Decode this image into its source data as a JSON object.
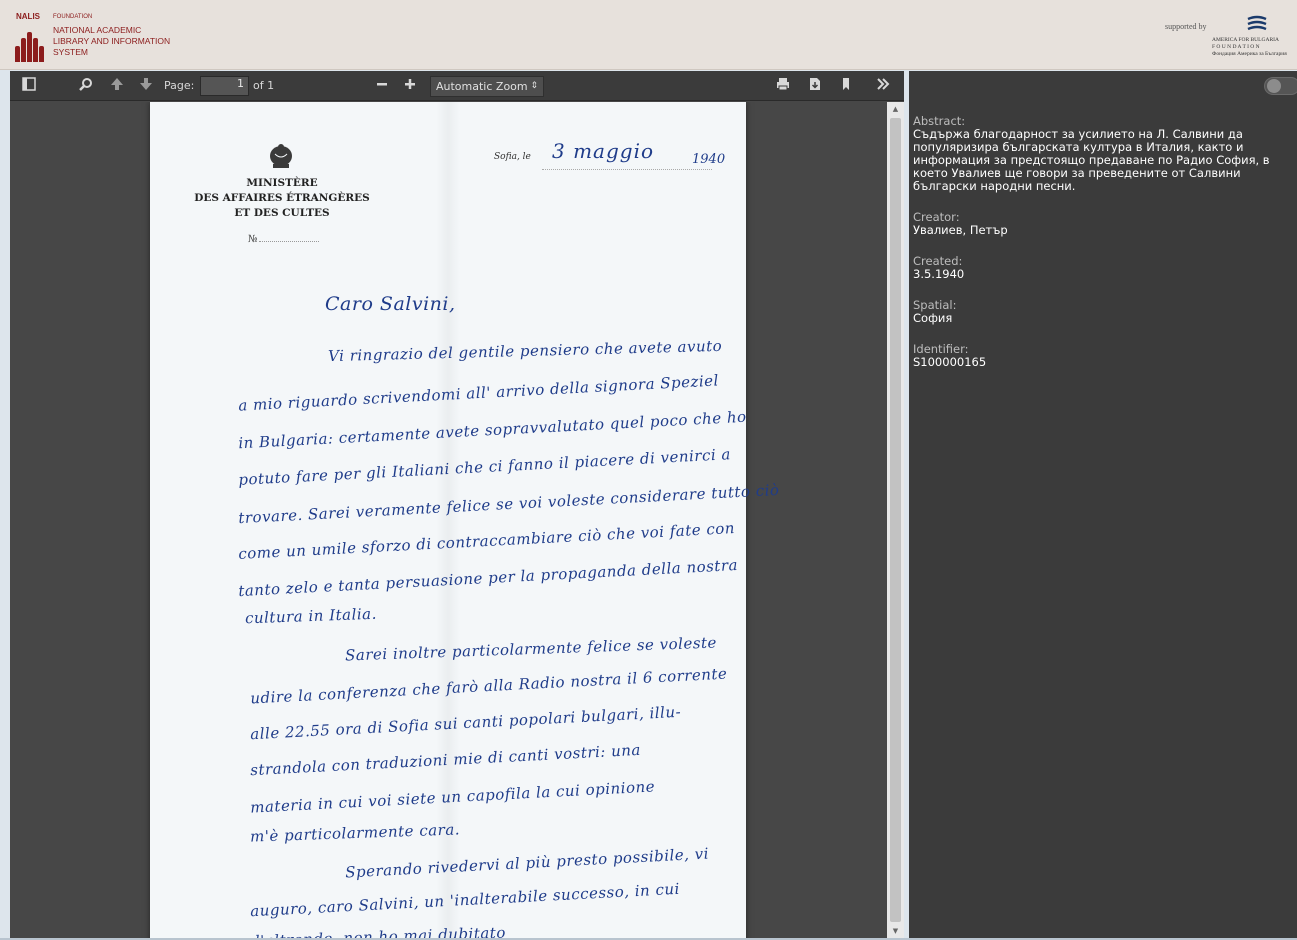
{
  "header": {
    "logo_top": "NALIS",
    "foundation": "FOUNDATION",
    "org_lines": [
      "NATIONAL ACADEMIC",
      "LIBRARY AND INFORMATION",
      "SYSTEM"
    ],
    "supported_by": "supported by",
    "sponsor_lines": [
      "AMERICA FOR BULGARIA",
      "F O U N D A T I O N",
      "Фондация Америка за България"
    ]
  },
  "toolbar": {
    "icons": [
      "sidebar-toggle-icon",
      "search-icon",
      "arrow-up-icon",
      "arrow-down-icon",
      "zoom-out-icon",
      "zoom-in-icon",
      "print-icon",
      "download-icon",
      "bookmark-icon",
      "double-chevron-right-icon"
    ],
    "page_label": "Page:",
    "page_value": "1",
    "page_of": "of 1",
    "zoom_minus": "—",
    "zoom_plus": "+",
    "zoom_value": "Automatic Zoom",
    "zoom_arrow": "⇕"
  },
  "document": {
    "ministry_lines": [
      "MINISTÈRE",
      "DES AFFAIRES ÉTRANGÈRES",
      "ET DES CULTES"
    ],
    "number_label": "№",
    "place_date": "Sofia, le",
    "date_hand": "3 maggio",
    "year_hand": "1940",
    "lines": [
      "Caro Salvini,",
      "Vi ringrazio del gentile pensiero che avete avuto",
      "a mio riguardo scrivendomi all' arrivo della signora Speziel",
      "in Bulgaria: certamente avete sopravvalutato quel poco che ho",
      "potuto fare per gli Italiani che ci fanno il piacere di venirci a",
      "trovare. Sarei veramente felice se voi voleste considerare tutto ciò",
      "come un umile sforzo di contraccambiare ciò che voi fate con",
      "tanto zelo e tanta persuasione per la propaganda della nostra",
      "cultura in Italia.",
      "Sarei inoltre particolarmente felice se voleste",
      "udire la conferenza che farò alla Radio nostra il 6 corrente",
      "alle 22.55 ora di Sofia sui canti popolari bulgari, illu-",
      "strandola con traduzioni mie di canti vostri: una",
      "materia in cui voi siete un capofila la cui opinione",
      "m'è particolarmente cara.",
      "Sperando rivedervi al più presto possibile, vi",
      "auguro, caro Salvini, un 'inalterabile successo, in cui",
      "d'altronde, non ho mai dubitato"
    ]
  },
  "metadata": [
    {
      "label": "Abstract:",
      "value": "Съдържа благодарност за усилието на Л. Салвини да популяризира българската култура в Италия, както и информация за предстоящо предаване по Радио София, в което Увалиев ще говори за преведените от Салвини български народни песни."
    },
    {
      "label": "Creator:",
      "value": "Увалиев, Петър"
    },
    {
      "label": "Created:",
      "value": "3.5.1940"
    },
    {
      "label": "Spatial:",
      "value": "София"
    },
    {
      "label": "Identifier:",
      "value": "S100000165"
    }
  ],
  "colors": {
    "brand_red": "#8c1c1c",
    "ink_blue": "#1f3c8a",
    "toolbar_bg": "#3b3b3b"
  }
}
